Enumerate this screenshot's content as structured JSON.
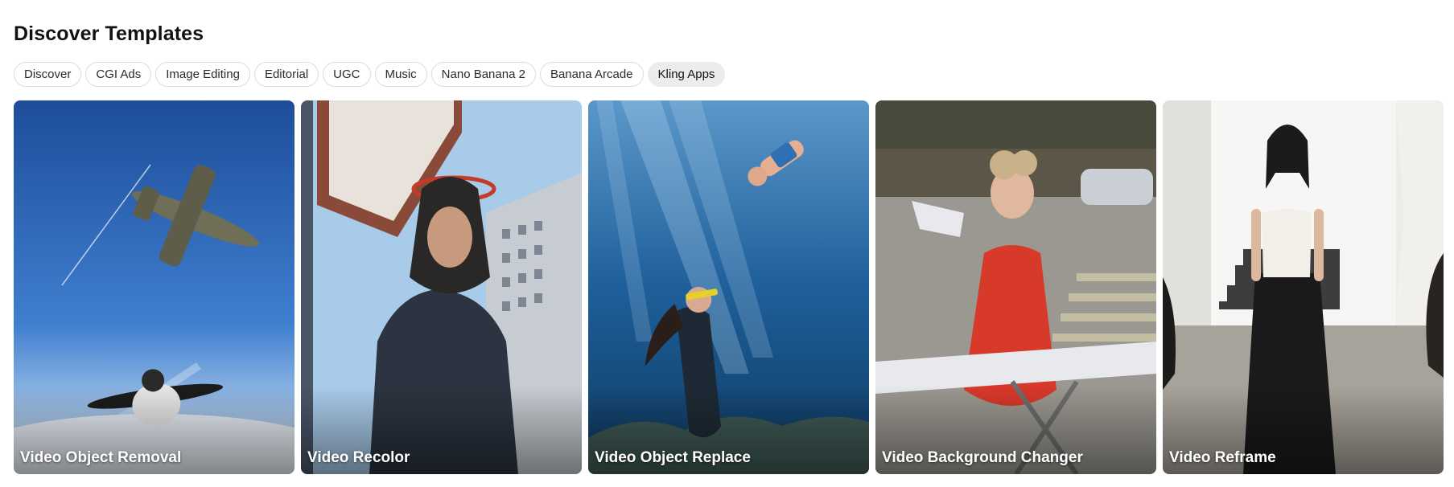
{
  "section": {
    "title": "Discover Templates"
  },
  "tabs": [
    {
      "label": "Discover",
      "active": false
    },
    {
      "label": "CGI Ads",
      "active": false
    },
    {
      "label": "Image Editing",
      "active": false
    },
    {
      "label": "Editorial",
      "active": false
    },
    {
      "label": "UGC",
      "active": false
    },
    {
      "label": "Music",
      "active": false
    },
    {
      "label": "Nano Banana 2",
      "active": false
    },
    {
      "label": "Banana Arcade",
      "active": false
    },
    {
      "label": "Kling Apps",
      "active": true
    }
  ],
  "cards": [
    {
      "label": "Video Object Removal"
    },
    {
      "label": "Video Recolor"
    },
    {
      "label": "Video Object Replace"
    },
    {
      "label": "Video Background Changer"
    },
    {
      "label": "Video Reframe"
    }
  ]
}
